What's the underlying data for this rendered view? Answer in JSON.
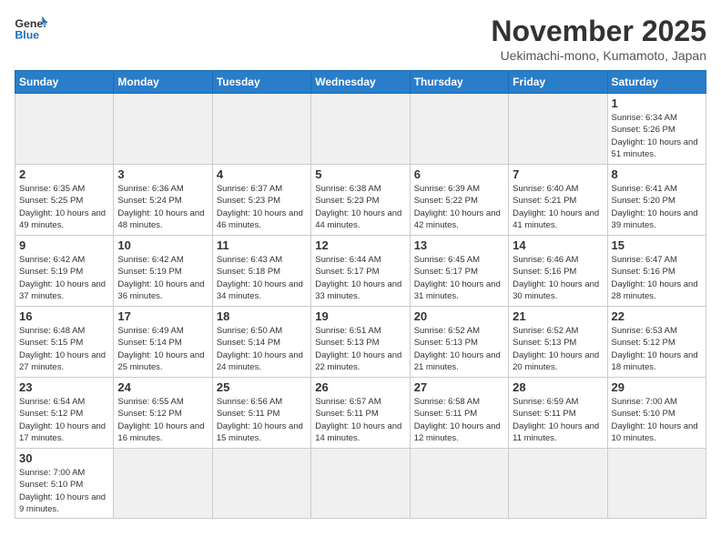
{
  "logo": {
    "text_general": "General",
    "text_blue": "Blue"
  },
  "header": {
    "month_title": "November 2025",
    "location": "Uekimachi-mono, Kumamoto, Japan"
  },
  "weekdays": [
    "Sunday",
    "Monday",
    "Tuesday",
    "Wednesday",
    "Thursday",
    "Friday",
    "Saturday"
  ],
  "weeks": [
    [
      {
        "day": "",
        "empty": true
      },
      {
        "day": "",
        "empty": true
      },
      {
        "day": "",
        "empty": true
      },
      {
        "day": "",
        "empty": true
      },
      {
        "day": "",
        "empty": true
      },
      {
        "day": "",
        "empty": true
      },
      {
        "day": "1",
        "info": "Sunrise: 6:34 AM\nSunset: 5:26 PM\nDaylight: 10 hours and 51 minutes."
      }
    ],
    [
      {
        "day": "2",
        "info": "Sunrise: 6:35 AM\nSunset: 5:25 PM\nDaylight: 10 hours and 49 minutes."
      },
      {
        "day": "3",
        "info": "Sunrise: 6:36 AM\nSunset: 5:24 PM\nDaylight: 10 hours and 48 minutes."
      },
      {
        "day": "4",
        "info": "Sunrise: 6:37 AM\nSunset: 5:23 PM\nDaylight: 10 hours and 46 minutes."
      },
      {
        "day": "5",
        "info": "Sunrise: 6:38 AM\nSunset: 5:23 PM\nDaylight: 10 hours and 44 minutes."
      },
      {
        "day": "6",
        "info": "Sunrise: 6:39 AM\nSunset: 5:22 PM\nDaylight: 10 hours and 42 minutes."
      },
      {
        "day": "7",
        "info": "Sunrise: 6:40 AM\nSunset: 5:21 PM\nDaylight: 10 hours and 41 minutes."
      },
      {
        "day": "8",
        "info": "Sunrise: 6:41 AM\nSunset: 5:20 PM\nDaylight: 10 hours and 39 minutes."
      }
    ],
    [
      {
        "day": "9",
        "info": "Sunrise: 6:42 AM\nSunset: 5:19 PM\nDaylight: 10 hours and 37 minutes."
      },
      {
        "day": "10",
        "info": "Sunrise: 6:42 AM\nSunset: 5:19 PM\nDaylight: 10 hours and 36 minutes."
      },
      {
        "day": "11",
        "info": "Sunrise: 6:43 AM\nSunset: 5:18 PM\nDaylight: 10 hours and 34 minutes."
      },
      {
        "day": "12",
        "info": "Sunrise: 6:44 AM\nSunset: 5:17 PM\nDaylight: 10 hours and 33 minutes."
      },
      {
        "day": "13",
        "info": "Sunrise: 6:45 AM\nSunset: 5:17 PM\nDaylight: 10 hours and 31 minutes."
      },
      {
        "day": "14",
        "info": "Sunrise: 6:46 AM\nSunset: 5:16 PM\nDaylight: 10 hours and 30 minutes."
      },
      {
        "day": "15",
        "info": "Sunrise: 6:47 AM\nSunset: 5:16 PM\nDaylight: 10 hours and 28 minutes."
      }
    ],
    [
      {
        "day": "16",
        "info": "Sunrise: 6:48 AM\nSunset: 5:15 PM\nDaylight: 10 hours and 27 minutes."
      },
      {
        "day": "17",
        "info": "Sunrise: 6:49 AM\nSunset: 5:14 PM\nDaylight: 10 hours and 25 minutes."
      },
      {
        "day": "18",
        "info": "Sunrise: 6:50 AM\nSunset: 5:14 PM\nDaylight: 10 hours and 24 minutes."
      },
      {
        "day": "19",
        "info": "Sunrise: 6:51 AM\nSunset: 5:13 PM\nDaylight: 10 hours and 22 minutes."
      },
      {
        "day": "20",
        "info": "Sunrise: 6:52 AM\nSunset: 5:13 PM\nDaylight: 10 hours and 21 minutes."
      },
      {
        "day": "21",
        "info": "Sunrise: 6:52 AM\nSunset: 5:13 PM\nDaylight: 10 hours and 20 minutes."
      },
      {
        "day": "22",
        "info": "Sunrise: 6:53 AM\nSunset: 5:12 PM\nDaylight: 10 hours and 18 minutes."
      }
    ],
    [
      {
        "day": "23",
        "info": "Sunrise: 6:54 AM\nSunset: 5:12 PM\nDaylight: 10 hours and 17 minutes."
      },
      {
        "day": "24",
        "info": "Sunrise: 6:55 AM\nSunset: 5:12 PM\nDaylight: 10 hours and 16 minutes."
      },
      {
        "day": "25",
        "info": "Sunrise: 6:56 AM\nSunset: 5:11 PM\nDaylight: 10 hours and 15 minutes."
      },
      {
        "day": "26",
        "info": "Sunrise: 6:57 AM\nSunset: 5:11 PM\nDaylight: 10 hours and 14 minutes."
      },
      {
        "day": "27",
        "info": "Sunrise: 6:58 AM\nSunset: 5:11 PM\nDaylight: 10 hours and 12 minutes."
      },
      {
        "day": "28",
        "info": "Sunrise: 6:59 AM\nSunset: 5:11 PM\nDaylight: 10 hours and 11 minutes."
      },
      {
        "day": "29",
        "info": "Sunrise: 7:00 AM\nSunset: 5:10 PM\nDaylight: 10 hours and 10 minutes."
      }
    ],
    [
      {
        "day": "30",
        "info": "Sunrise: 7:00 AM\nSunset: 5:10 PM\nDaylight: 10 hours and 9 minutes."
      },
      {
        "day": "",
        "empty": true
      },
      {
        "day": "",
        "empty": true
      },
      {
        "day": "",
        "empty": true
      },
      {
        "day": "",
        "empty": true
      },
      {
        "day": "",
        "empty": true
      },
      {
        "day": "",
        "empty": true
      }
    ]
  ]
}
